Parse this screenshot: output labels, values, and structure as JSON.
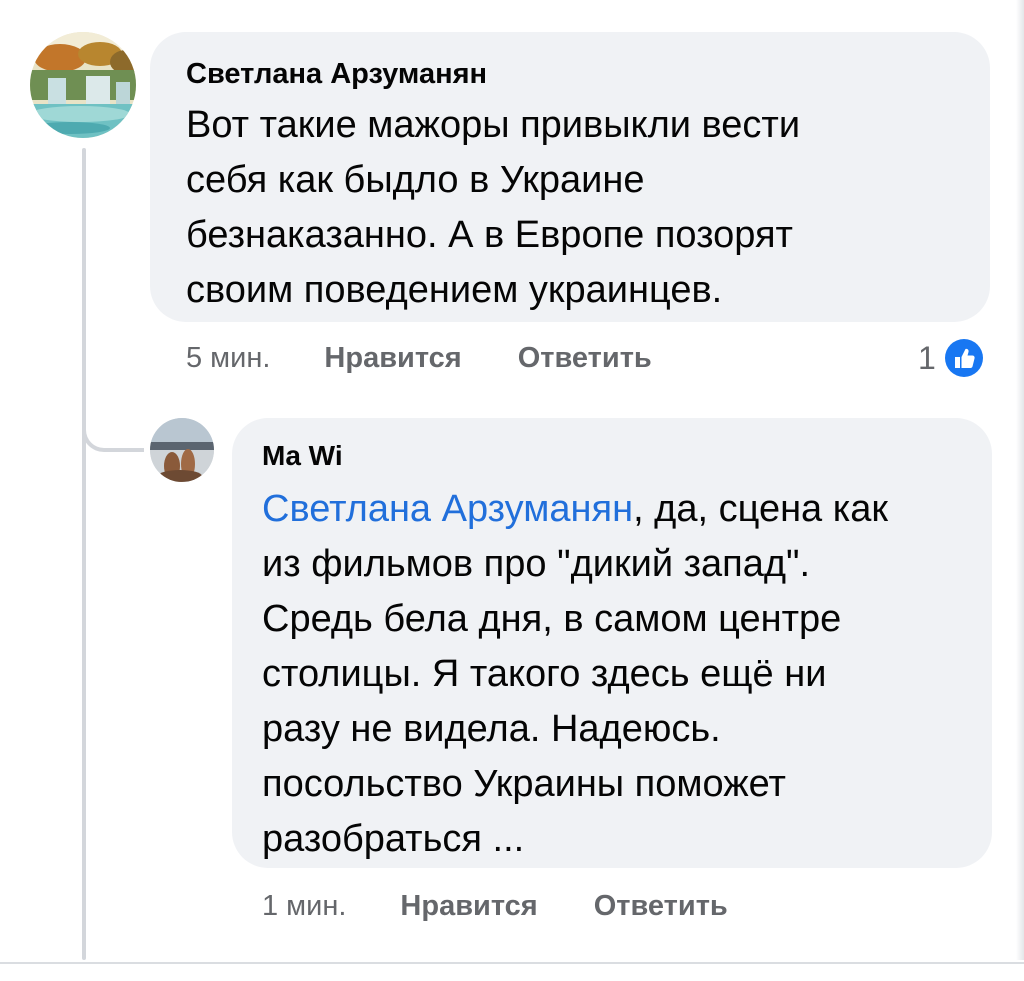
{
  "comments": [
    {
      "author": "Светлана Арзуманян",
      "lines": [
        "Вот такие мажоры привыкли вести",
        "себя как быдло в Украине",
        "безнаказанно. А в Европе позорят",
        "своим поведением украинцев."
      ],
      "time": "5 мин.",
      "like_label": "Нравится",
      "reply_label": "Ответить",
      "reaction_count": "1",
      "reaction_icon": "like-icon",
      "colors": {
        "reaction_bg": "#1877f2"
      }
    }
  ],
  "reply": {
    "author": "Ma Wi",
    "mention": "Светлана Арзуманян",
    "first_line_rest": ", да, сцена как",
    "lines": [
      "из фильмов про \"дикий запад\".",
      "Средь бела дня, в самом центре",
      "столицы. Я такого здесь ещё ни",
      "разу не видела. Надеюсь.",
      "посольство Украины поможет",
      "разобраться ..."
    ],
    "time": "1 мин.",
    "like_label": "Нравится",
    "reply_label": "Ответить",
    "colors": {
      "mention": "#216fdb"
    }
  }
}
